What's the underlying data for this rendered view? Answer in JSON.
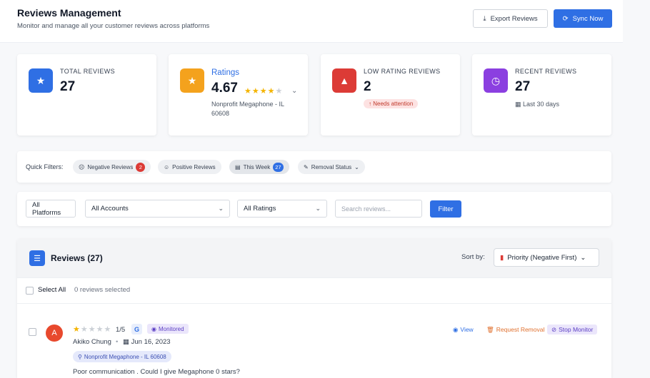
{
  "header": {
    "title": "Reviews Management",
    "subtitle": "Monitor and manage all your customer reviews across platforms",
    "export_label": "Export Reviews",
    "sync_label": "Sync Now"
  },
  "stats": {
    "total": {
      "label": "TOTAL REVIEWS",
      "value": "27",
      "icon": "star-icon",
      "color": "#2f6fe4"
    },
    "ratings": {
      "label": "Ratings",
      "value": "4.67",
      "stars": "★★★★★",
      "location": "Nonprofit Megaphone - IL 60608",
      "icon": "star-icon",
      "color": "#f4a21d"
    },
    "low": {
      "label": "LOW RATING REVIEWS",
      "value": "2",
      "badge": "Needs attention",
      "icon": "warning-icon",
      "color": "#dc3b36"
    },
    "recent": {
      "label": "RECENT REVIEWS",
      "value": "27",
      "period": "Last 30 days",
      "icon": "clock-icon",
      "color": "#8b3fe0"
    }
  },
  "quick_filters": {
    "label": "Quick Filters:",
    "chips": [
      {
        "label": "Negative Reviews",
        "badge": "2"
      },
      {
        "label": "Positive Reviews"
      },
      {
        "label": "This Week",
        "badge": "27"
      },
      {
        "label": "Removal Status"
      }
    ]
  },
  "filters": {
    "platform": "All Platforms",
    "accounts": "All Accounts",
    "ratings": "All Ratings",
    "search_placeholder": "Search reviews...",
    "filter_label": "Filter"
  },
  "reviews": {
    "title": "Reviews (27)",
    "sort_label": "Sort by:",
    "sort_value": "Priority (Negative First)",
    "select_all": "Select All",
    "selected_count": "0 reviews selected",
    "items": [
      {
        "avatar": "A",
        "rating": 1,
        "score": "1/5",
        "platform": "G",
        "status": "Monitored",
        "author": "Akiko Chung",
        "date": "Jun 16, 2023",
        "location": "Nonprofit Megaphone - IL 60608",
        "text": "Poor communication . Could I give Megaphone 0 stars?",
        "actions": {
          "view": "View",
          "request_removal": "Request Removal",
          "stop_monitor": "Stop Monitor"
        }
      }
    ]
  }
}
